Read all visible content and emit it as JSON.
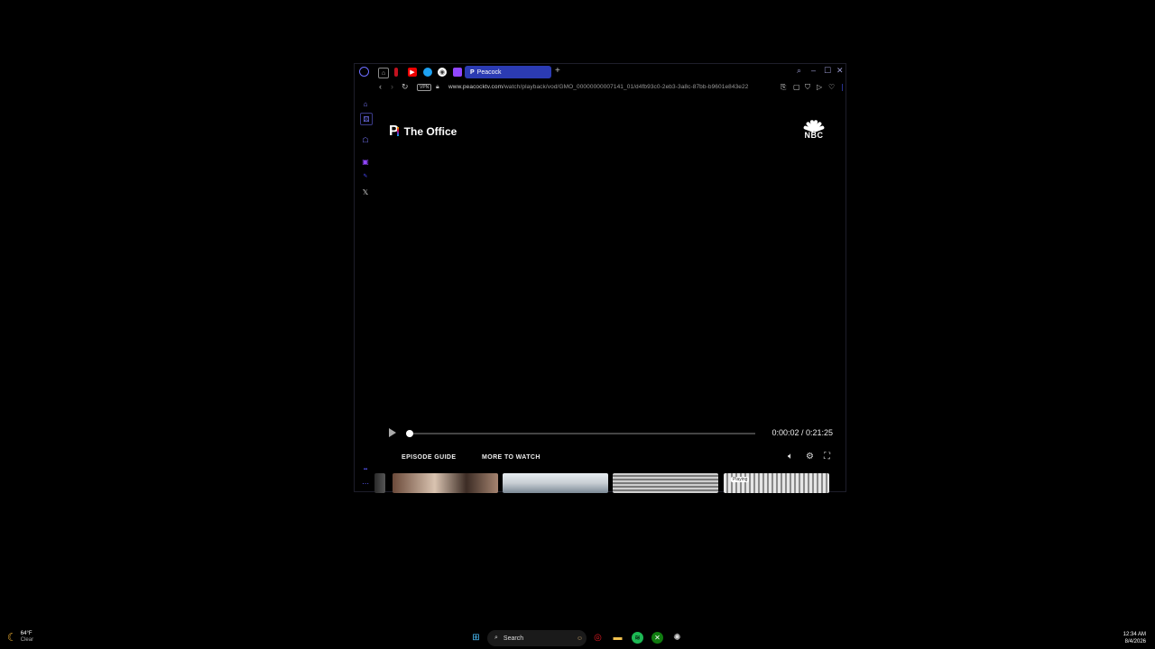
{
  "browser": {
    "tab_label": "Peacock",
    "tab_favicon": "P",
    "new_tab": "+",
    "url_domain": "www.peacocktv.com",
    "url_path": "/watch/playback/vod/GMO_00000000007141_01/d4fb93c0-2eb3-3a8c-87bb-b9601e843e22",
    "vpn_label": "VPN"
  },
  "player": {
    "show_title": "The Office",
    "network_logo": "NBC",
    "time_display": "0:00:02 / 0:21:25",
    "progress_fraction": 0.0016,
    "links": [
      "EPISODE GUIDE",
      "MORE TO WATCH"
    ],
    "playing_badge": "Playing"
  },
  "taskbar": {
    "weather_temp": "64°F",
    "weather_cond": "Clear",
    "search_placeholder": "Search",
    "time": "12:34 AM",
    "date": "8/4/2026"
  },
  "colors": {
    "accent": "#2b3bb3",
    "rail": "#6d6dff"
  }
}
